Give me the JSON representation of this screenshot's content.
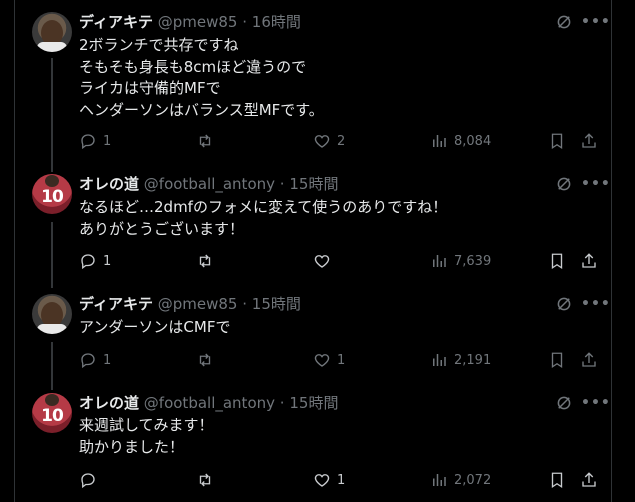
{
  "tweets": [
    {
      "name": "ディアキテ",
      "handle": "@pmew85",
      "dot": "·",
      "time": "16時間",
      "lines": "2ボランチで共存ですね\nそもそも身長も8cmほど違うので\nライカは守備的MFで\nヘンダーソンはバランス型MFです。",
      "replies": "1",
      "reposts": "",
      "likes": "2",
      "views": "8,084"
    },
    {
      "name": "オレの道",
      "handle": "@football_antony",
      "dot": "·",
      "time": "15時間",
      "lines": "なるほど…2dmfのフォメに変えて使うのありですね！\nありがとうございます！",
      "replies": "1",
      "reposts": "",
      "likes": "",
      "views": "7,639"
    },
    {
      "name": "ディアキテ",
      "handle": "@pmew85",
      "dot": "·",
      "time": "15時間",
      "lines": "アンダーソンはCMFで",
      "replies": "1",
      "reposts": "",
      "likes": "1",
      "views": "2,191"
    },
    {
      "name": "オレの道",
      "handle": "@football_antony",
      "dot": "·",
      "time": "15時間",
      "lines": "来週試してみます！\n助かりました！",
      "replies": "",
      "reposts": "",
      "likes": "1",
      "views": "2,072"
    }
  ],
  "avatar_number": "10",
  "icons": {
    "reply": "reply-icon",
    "repost": "repost-icon",
    "like": "heart-icon",
    "views": "views-icon",
    "bookmark": "bookmark-icon",
    "share": "share-icon",
    "grok": "grok-icon",
    "more": "more-icon"
  },
  "colors": {
    "background": "#000000",
    "text": "#e7e9ea",
    "muted": "#71767b",
    "divider": "#2f3336"
  }
}
